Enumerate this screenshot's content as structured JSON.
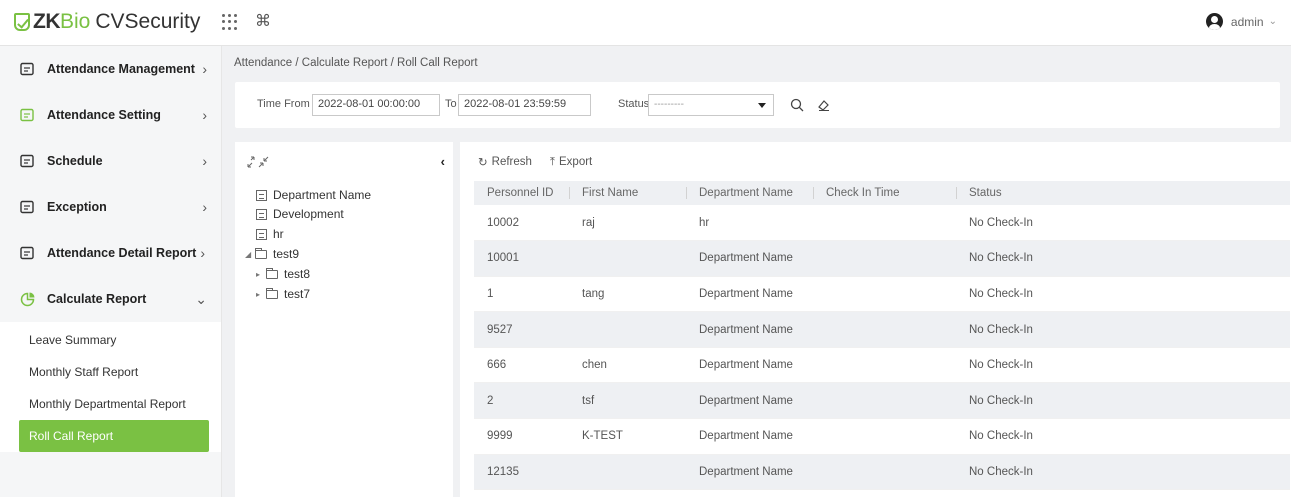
{
  "brand": {
    "zk": "ZK",
    "bio": "Bio",
    "cv": "CVSecurity",
    "accent": "#7ac143"
  },
  "header": {
    "user": "admin"
  },
  "sidebar": {
    "items": [
      {
        "label": "Attendance Management",
        "icon": "attendance-management-icon",
        "arrow": ">"
      },
      {
        "label": "Attendance Setting",
        "icon": "attendance-setting-icon",
        "arrow": ">"
      },
      {
        "label": "Schedule",
        "icon": "schedule-icon",
        "arrow": ">"
      },
      {
        "label": "Exception",
        "icon": "exception-icon",
        "arrow": ">"
      },
      {
        "label": "Attendance Detail Report",
        "icon": "detail-report-icon",
        "arrow": ">"
      },
      {
        "label": "Calculate Report",
        "icon": "calculate-report-icon",
        "arrow": "v"
      }
    ],
    "submenu": [
      {
        "label": "Leave Summary"
      },
      {
        "label": "Monthly Staff Report"
      },
      {
        "label": "Monthly Departmental Report"
      },
      {
        "label": "Roll Call Report",
        "active": true
      }
    ]
  },
  "breadcrumb": "Attendance / Calculate Report / Roll Call Report",
  "search": {
    "time_from_label": "Time From",
    "time_from_value": "2022-08-01 00:00:00",
    "to_label": "To",
    "to_value": "2022-08-01 23:59:59",
    "status_label": "Status",
    "status_value": "---------"
  },
  "tree": {
    "nodes": [
      {
        "label": "Department Name",
        "type": "doc",
        "level": 0
      },
      {
        "label": "Development",
        "type": "doc",
        "level": 0
      },
      {
        "label": "hr",
        "type": "doc",
        "level": 0
      },
      {
        "label": "test9",
        "type": "folder-open",
        "level": 0
      },
      {
        "label": "test8",
        "type": "folder",
        "level": 1
      },
      {
        "label": "test7",
        "type": "folder",
        "level": 1
      }
    ]
  },
  "toolbar": {
    "refresh": "Refresh",
    "export": "Export"
  },
  "table": {
    "columns": [
      "Personnel ID",
      "First Name",
      "Department Name",
      "Check In Time",
      "Status"
    ],
    "rows": [
      [
        "10002",
        "raj",
        "hr",
        "",
        "No Check-In"
      ],
      [
        "10001",
        "",
        "Department Name",
        "",
        "No Check-In"
      ],
      [
        "1",
        "tang",
        "Department Name",
        "",
        "No Check-In"
      ],
      [
        "9527",
        "",
        "Department Name",
        "",
        "No Check-In"
      ],
      [
        "666",
        "chen",
        "Department Name",
        "",
        "No Check-In"
      ],
      [
        "2",
        "tsf",
        "Department Name",
        "",
        "No Check-In"
      ],
      [
        "9999",
        "K-TEST",
        "Department Name",
        "",
        "No Check-In"
      ],
      [
        "12135",
        "",
        "Department Name",
        "",
        "No Check-In"
      ]
    ]
  }
}
